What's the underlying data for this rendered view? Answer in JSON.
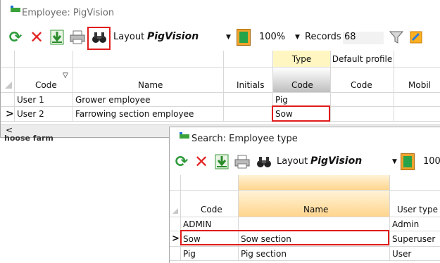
{
  "top_window": {
    "title": "Employee: PigVision",
    "toolbar": {
      "layout_label": "Layout",
      "layout_value": "PigVision",
      "zoom": "100%",
      "records_label": "Records",
      "records_count": "68"
    },
    "grid": {
      "group_headers": {
        "type": "Type",
        "default_profile": "Default profile"
      },
      "columns": {
        "code": "Code",
        "name": "Name",
        "initials": "Initials",
        "type_code": "Code",
        "profile_code": "Code",
        "mobil": "Mobil"
      },
      "rows": [
        {
          "code": "User 1",
          "name": "Grower employee",
          "initials": "",
          "type_code": "Pig"
        },
        {
          "code": "User 2",
          "name": "Farrowing section employee",
          "initials": "",
          "type_code": "Sow",
          "current_marker": ">"
        }
      ]
    },
    "scroll_left": "<",
    "partial_text": "hoose farm"
  },
  "search_window": {
    "title": "Search: Employee type",
    "toolbar": {
      "layout_label": "Layout",
      "layout_value": "PigVision",
      "zoom": "100"
    },
    "grid": {
      "columns": {
        "code": "Code",
        "name": "Name",
        "user_type": "User type"
      },
      "rows": [
        {
          "code": "ADMIN",
          "name": "",
          "user_type": "Admin"
        },
        {
          "code": "Sow",
          "name": "Sow section",
          "user_type": "Superuser",
          "current_marker": ">"
        },
        {
          "code": "Pig",
          "name": "Pig section",
          "user_type": "User"
        }
      ]
    }
  },
  "icons": [
    "refresh-icon",
    "delete-icon",
    "export-icon",
    "print-icon",
    "binoculars-icon",
    "layout-icon",
    "filter-icon",
    "settings-icon"
  ],
  "colors": {
    "highlight_red": "#e01b1b",
    "type_header_yellow": "#fff6c2",
    "green_accent": "#2e9b3c"
  }
}
